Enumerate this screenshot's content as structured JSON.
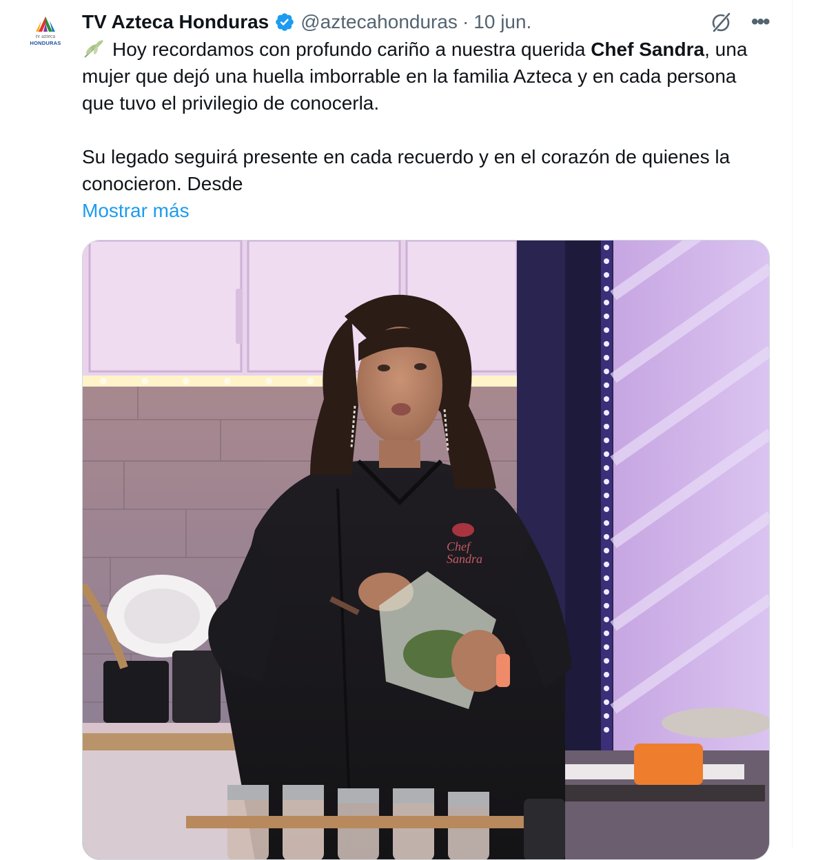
{
  "tweet": {
    "author_name": "TV Azteca Honduras",
    "handle": "@aztecahonduras",
    "separator": "·",
    "date": "10 jun.",
    "avatar": {
      "line1": "tv azteca",
      "line2": "HONDURAS"
    },
    "body": {
      "lead_emoji": "herb-icon",
      "line1_pre": "Hoy recordamos con profundo cariño a nuestra querida ",
      "line1_bold": "Chef Sandra",
      "line1_post": ", una mujer que dejó una huella imborrable en la familia Azteca y en cada persona que tuvo el privilegio de conocerla.",
      "paragraph2": "Su legado seguirá presente en cada recuerdo y en el corazón de quienes la conocieron. Desde"
    },
    "show_more": "Mostrar más",
    "media": {
      "apron_text_line1": "Chef",
      "apron_text_line2": "Sandra"
    }
  },
  "colors": {
    "accent": "#1d9bf0",
    "secondary_text": "#536471",
    "verified": "#1d9bf0",
    "primary_text": "#0f1419"
  },
  "icons": [
    "verified-badge-icon",
    "grok-icon",
    "more-icon",
    "herb-icon"
  ]
}
